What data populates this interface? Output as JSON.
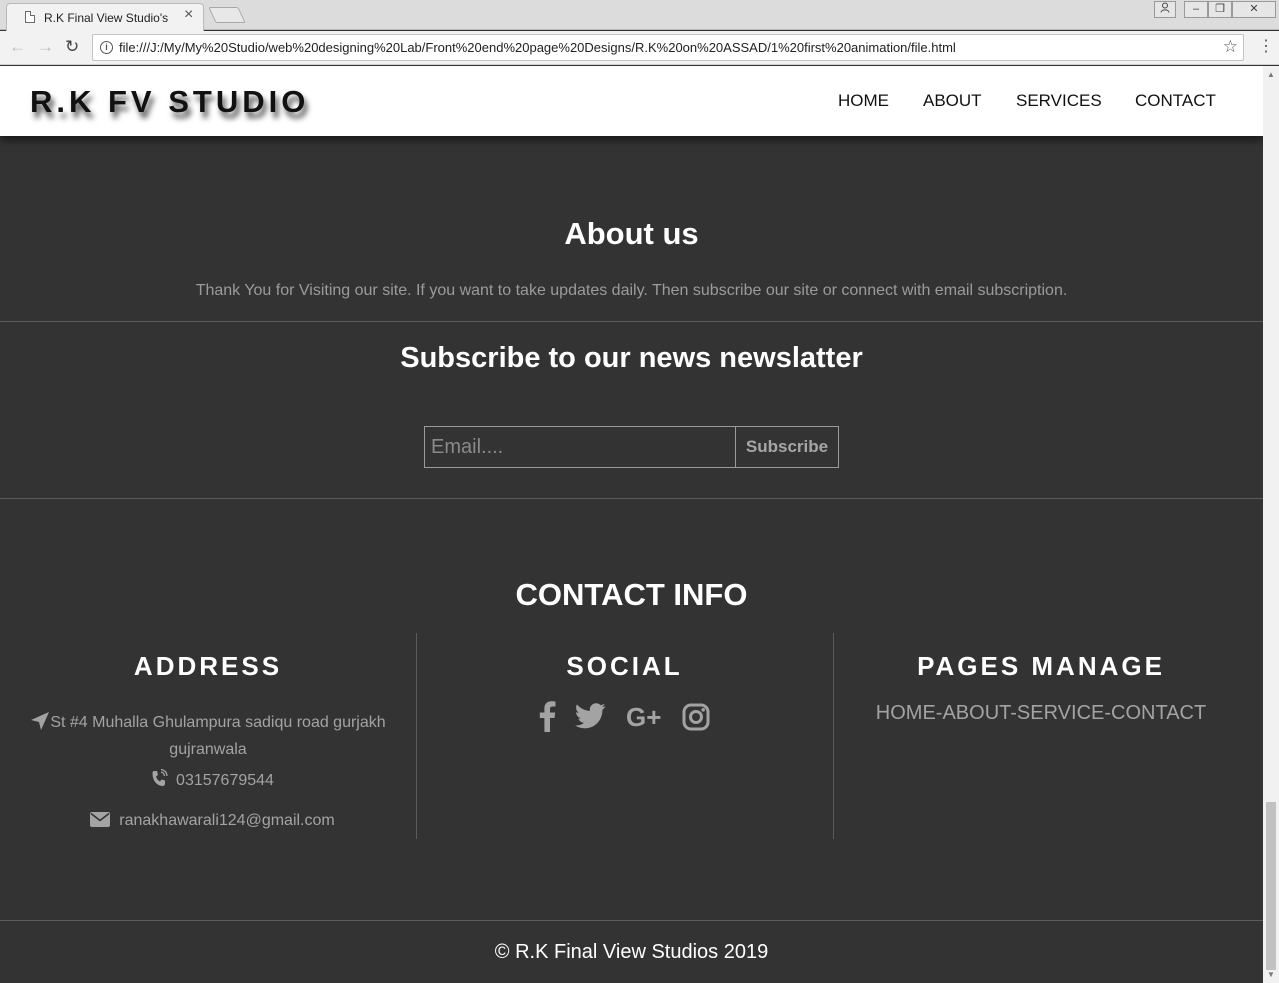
{
  "browser": {
    "tab_title": "R.K Final View Studio's S",
    "tab_close": "×",
    "url": "file:///J:/My/My%20Studio/web%20designing%20Lab/Front%20end%20page%20Designs/R.K%20on%20ASSAD/1%20first%20animation/file.html",
    "back": "←",
    "forward": "→",
    "reload": "↻",
    "star": "☆",
    "menu": "⋮",
    "info": "i"
  },
  "header": {
    "logo": "R.K FV STUDIO",
    "nav": [
      "HOME",
      "ABOUT",
      "SERVICES",
      "CONTACT"
    ]
  },
  "about": {
    "title": "About us",
    "text": "Thank You for Visiting our site. If you want to take updates daily. Then subscribe our site or connect with email subscription."
  },
  "newsletter": {
    "title": "Subscribe to our news newslatter",
    "placeholder": "Email....",
    "button": "Subscribe"
  },
  "contact": {
    "title": "CONTACT INFO",
    "address": {
      "heading": "ADDRESS",
      "line1": "St #4 Muhalla Ghulampura sadiqu road gurjakh",
      "line2": "gujranwala",
      "phone": "03157679544",
      "email": "ranakhawarali124@gmail.com"
    },
    "social": {
      "heading": "SOCIAL",
      "icons": [
        "facebook-icon",
        "twitter-icon",
        "google-plus-icon",
        "instagram-icon"
      ],
      "google_plus_glyph": "G+"
    },
    "pages": {
      "heading": "PAGES MANAGE",
      "links": "HOME-ABOUT-SERVICE-CONTACT"
    }
  },
  "footer": {
    "copyright": "© R.K Final View Studios 2019"
  },
  "colors": {
    "background": "#333333",
    "header": "#ffffff",
    "muted_text": "#a3a3a3",
    "divider": "#5b5b5b"
  }
}
